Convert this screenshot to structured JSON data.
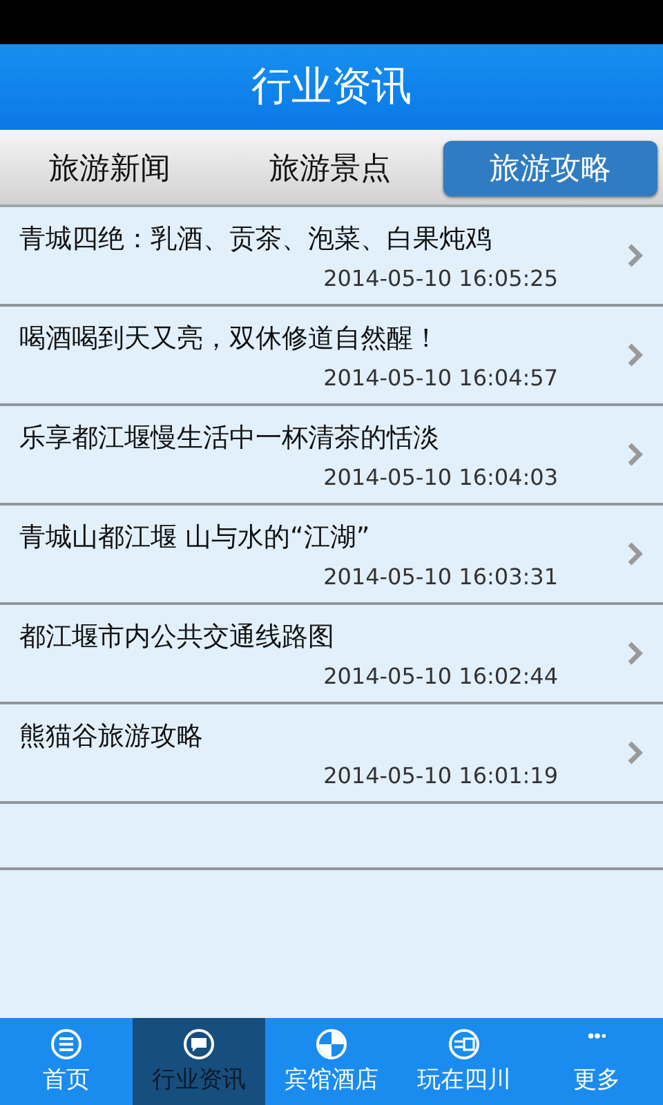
{
  "header": {
    "title": "行业资讯"
  },
  "tabs": [
    {
      "label": "旅游新闻",
      "selected": false
    },
    {
      "label": "旅游景点",
      "selected": false
    },
    {
      "label": "旅游攻略",
      "selected": true
    }
  ],
  "articles": [
    {
      "title": "青城四绝：乳酒、贡茶、泡菜、白果炖鸡",
      "time": "2014-05-10 16:05:25"
    },
    {
      "title": "喝酒喝到天又亮，双休修道自然醒！",
      "time": "2014-05-10 16:04:57"
    },
    {
      "title": "乐享都江堰慢生活中一杯清茶的恬淡",
      "time": "2014-05-10 16:04:03"
    },
    {
      "title": "青城山都江堰 山与水的“江湖”",
      "time": "2014-05-10 16:03:31"
    },
    {
      "title": "都江堰市内公共交通线路图",
      "time": "2014-05-10 16:02:44"
    },
    {
      "title": "熊猫谷旅游攻略",
      "time": "2014-05-10 16:01:19"
    }
  ],
  "bottom_nav": [
    {
      "label": "首页",
      "selected": false
    },
    {
      "label": "行业资讯",
      "selected": true
    },
    {
      "label": "宾馆酒店",
      "selected": false
    },
    {
      "label": "玩在四川",
      "selected": false
    },
    {
      "label": "更多",
      "selected": false
    }
  ]
}
